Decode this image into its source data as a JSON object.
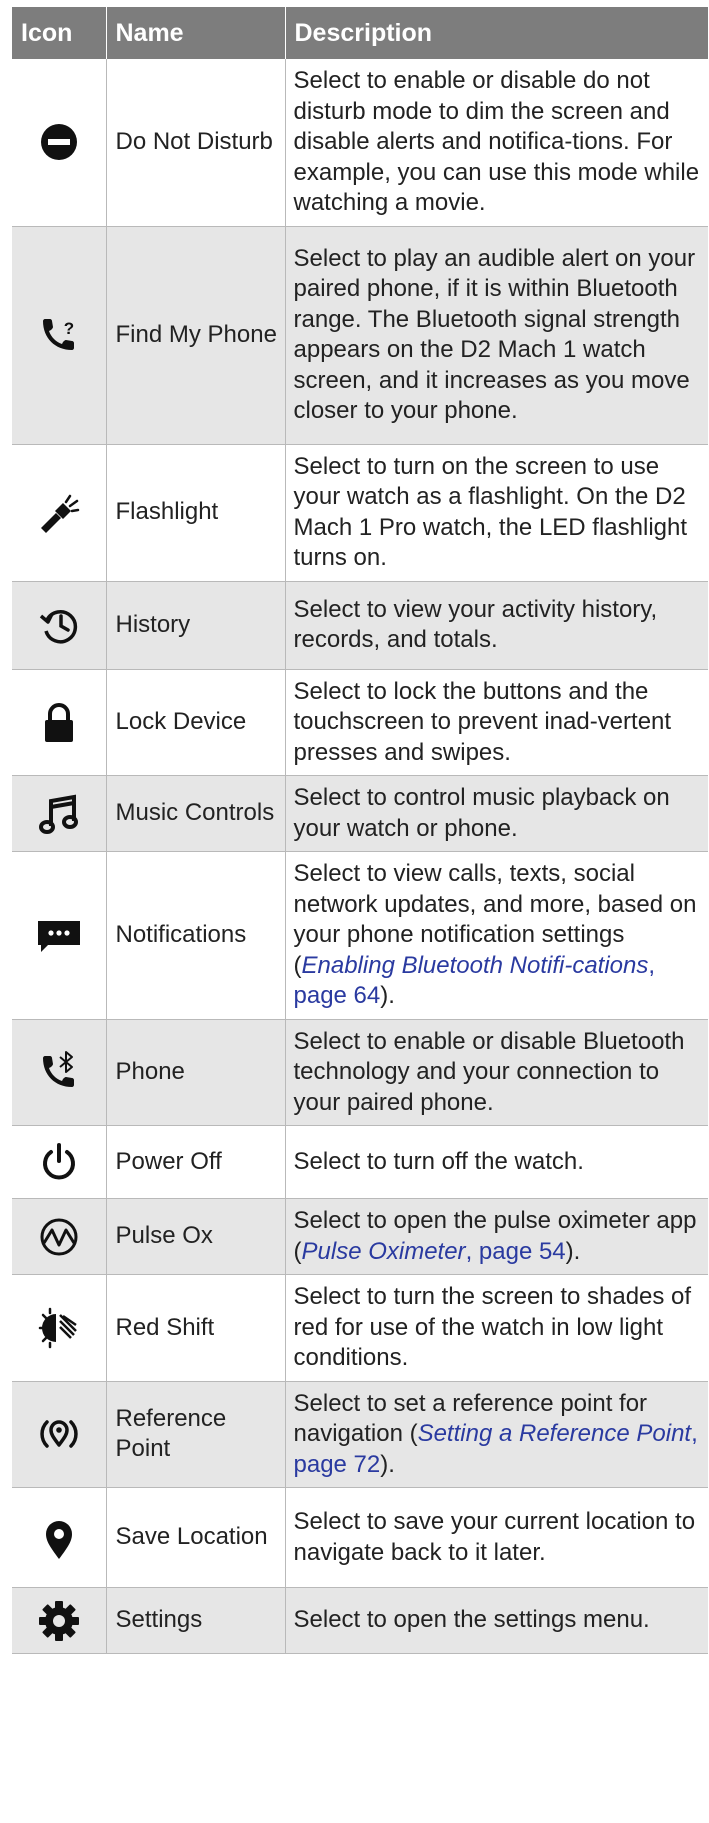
{
  "header": {
    "icon": "Icon",
    "name": "Name",
    "description": "Description"
  },
  "rows": [
    {
      "icon": "do-not-disturb-icon",
      "name": "Do Not Disturb",
      "desc": "Select to enable or disable do not disturb mode to dim the screen and disable alerts and notifica-tions. For example, you can use this mode while watching a movie."
    },
    {
      "icon": "find-my-phone-icon",
      "name": "Find My Phone",
      "desc": "Select to play an audible alert on your paired phone, if it is within Bluetooth range. The Bluetooth signal strength appears on the D2 Mach 1 watch screen, and it increases as you move closer to your phone."
    },
    {
      "icon": "flashlight-icon",
      "name": "Flashlight",
      "desc": "Select to turn on the screen to use your watch as a flashlight. On the D2 Mach 1 Pro watch, the LED flashlight turns on."
    },
    {
      "icon": "history-icon",
      "name": "History",
      "desc": "Select to view your activity history, records, and totals."
    },
    {
      "icon": "lock-icon",
      "name": "Lock Device",
      "desc": "Select to lock the buttons and the touchscreen to prevent inad-vertent presses and swipes."
    },
    {
      "icon": "music-note-icon",
      "name": "Music Controls",
      "desc": "Select to control music playback on your watch or phone."
    },
    {
      "icon": "notifications-icon",
      "name": "Notifications",
      "desc_pre": "Select to view calls, texts, social network updates, and more, based on your phone notification settings (",
      "link_title": "Enabling Bluetooth Notifi-cations",
      "link_page": ", page 64",
      "desc_post": ")."
    },
    {
      "icon": "phone-bluetooth-icon",
      "name": "Phone",
      "desc": "Select to enable or disable Bluetooth technology and your connection to your paired phone."
    },
    {
      "icon": "power-icon",
      "name": "Power Off",
      "desc": "Select to turn off the watch."
    },
    {
      "icon": "pulse-ox-icon",
      "name": "Pulse Ox",
      "desc_pre": "Select to open the pulse oximeter app (",
      "link_title": "Pulse Oximeter",
      "link_page": ", page 54",
      "desc_post": ")."
    },
    {
      "icon": "red-shift-icon",
      "name": "Red Shift",
      "desc": "Select to turn the screen to shades of red for use of the watch in low light conditions."
    },
    {
      "icon": "reference-point-icon",
      "name": "Reference Point",
      "desc_pre": "Select to set a reference point for navigation (",
      "link_title": "Setting a Reference Point",
      "link_page": ", page 72",
      "desc_post": ")."
    },
    {
      "icon": "location-pin-icon",
      "name": "Save Location",
      "desc": "Select to save your current location to navigate back to it later."
    },
    {
      "icon": "settings-gear-icon",
      "name": "Settings",
      "desc": "Select to open the settings menu."
    }
  ]
}
